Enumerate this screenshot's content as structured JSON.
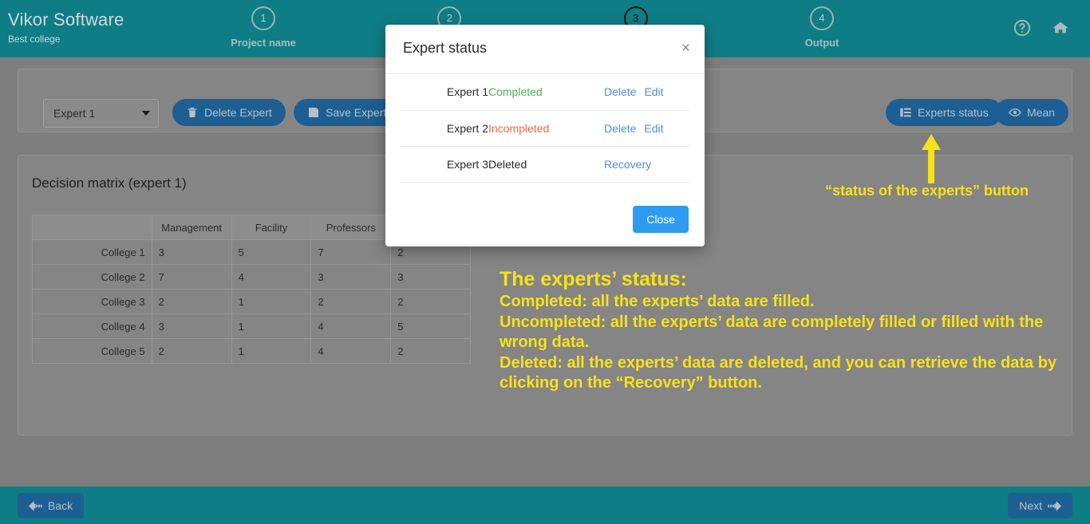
{
  "header": {
    "brand_title": "Vikor Software",
    "brand_subtitle": "Best college",
    "steps": [
      {
        "number": "1",
        "label": "Project name"
      },
      {
        "number": "2",
        "label": ""
      },
      {
        "number": "3",
        "label": ""
      },
      {
        "number": "4",
        "label": "Output"
      }
    ],
    "help_icon": "help-circle-icon",
    "home_icon": "home-icon"
  },
  "toolbar": {
    "expert_select_value": "Expert 1",
    "delete_expert_label": "Delete Expert",
    "save_expert_label": "Save Expert",
    "experts_status_label": "Experts status",
    "mean_label": "Mean"
  },
  "matrix": {
    "title": "Decision matrix (expert 1)",
    "columns": [
      "",
      "Management",
      "Facility",
      "Professors",
      ""
    ],
    "rows": [
      {
        "name": "College 1",
        "values": [
          "3",
          "5",
          "7",
          "2"
        ]
      },
      {
        "name": "College 2",
        "values": [
          "7",
          "4",
          "3",
          "3"
        ]
      },
      {
        "name": "College 3",
        "values": [
          "2",
          "1",
          "2",
          "2"
        ]
      },
      {
        "name": "College 4",
        "values": [
          "3",
          "1",
          "4",
          "5"
        ]
      },
      {
        "name": "College 5",
        "values": [
          "2",
          "1",
          "4",
          "2"
        ]
      }
    ]
  },
  "modal": {
    "title": "Expert status",
    "close_x": "×",
    "rows": [
      {
        "name": "Expert 1",
        "status": "Completed",
        "status_kind": "completed",
        "actions": [
          "Delete",
          "Edit"
        ]
      },
      {
        "name": "Expert 2",
        "status": "Incompleted",
        "status_kind": "incompleted",
        "actions": [
          "Delete",
          "Edit"
        ]
      },
      {
        "name": "Expert 3",
        "status": "Deleted",
        "status_kind": "deleted",
        "actions": [
          "Recovery"
        ]
      }
    ],
    "close_button": "Close"
  },
  "annotations": {
    "arrow_label": "“status of the experts” button",
    "heading": "The experts’ status:",
    "lines": [
      "Completed: all the experts’ data are filled.",
      "Uncompleted: all the experts’ data are completely filled or filled with the wrong data.",
      "Deleted: all the experts’ data are deleted, and you can  retrieve the data by clicking on the “Recovery” button."
    ],
    "color": "#f7e119"
  },
  "footer": {
    "back_label": "Back",
    "next_label": "Next"
  },
  "colors": {
    "header_teal": "#0f7d85",
    "overlay_gray": "#7e7e7e",
    "button_blue": "#1d5f93",
    "modal_blue": "#2d9bf0",
    "link_blue": "#4a8bf5",
    "status_green": "#4caf50",
    "status_red": "#f4654a",
    "annotation_yellow": "#f7e119"
  }
}
